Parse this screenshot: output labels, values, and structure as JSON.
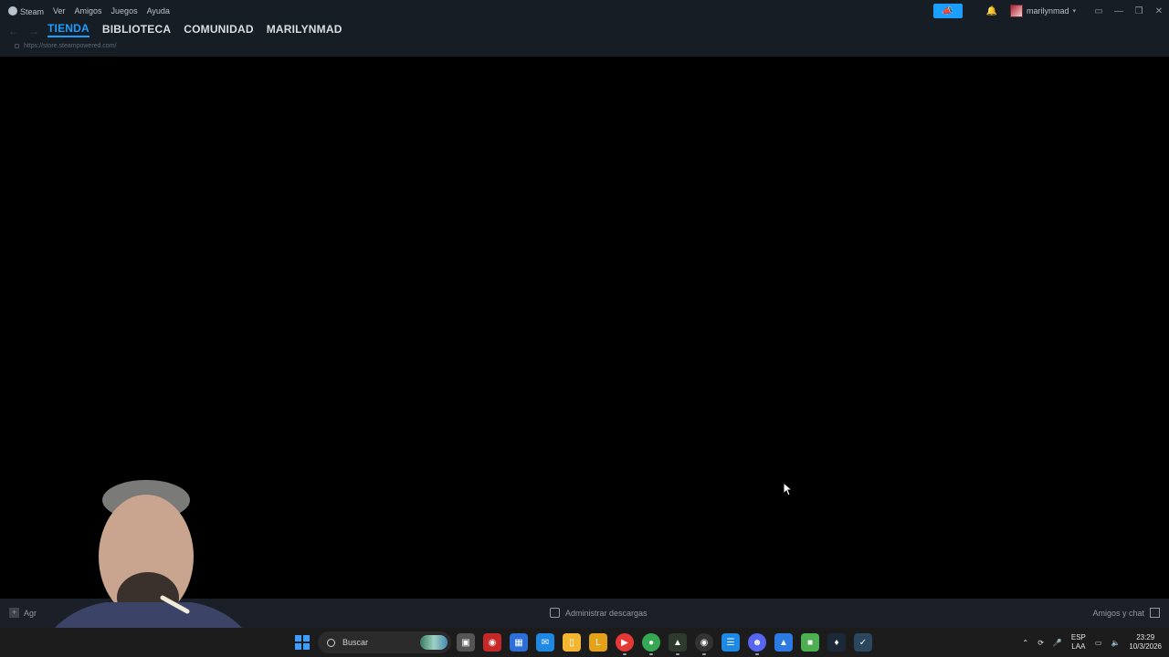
{
  "menu": {
    "items": [
      "Steam",
      "Ver",
      "Amigos",
      "Juegos",
      "Ayuda"
    ]
  },
  "header": {
    "username": "marilynmad",
    "announce_icon": "megaphone-icon",
    "bell_icon": "bell-icon"
  },
  "nav": {
    "tabs": [
      {
        "label": "TIENDA",
        "active": true
      },
      {
        "label": "BIBLIOTECA",
        "active": false
      },
      {
        "label": "COMUNIDAD",
        "active": false
      },
      {
        "label": "MARILYNMAD",
        "active": false
      }
    ],
    "url": "https://store.steampowered.com/"
  },
  "bottom": {
    "add_game": "Agr",
    "downloads": "Administrar descargas",
    "friends": "Amigos y chat"
  },
  "taskbar": {
    "search_placeholder": "Buscar",
    "lang_top": "ESP",
    "lang_bottom": "LAA",
    "time": "23:29",
    "date": "10/3/2026"
  },
  "colors": {
    "accent": "#1a9fff",
    "chrome": "#171d25",
    "taskbar": "#1c1c1c"
  }
}
